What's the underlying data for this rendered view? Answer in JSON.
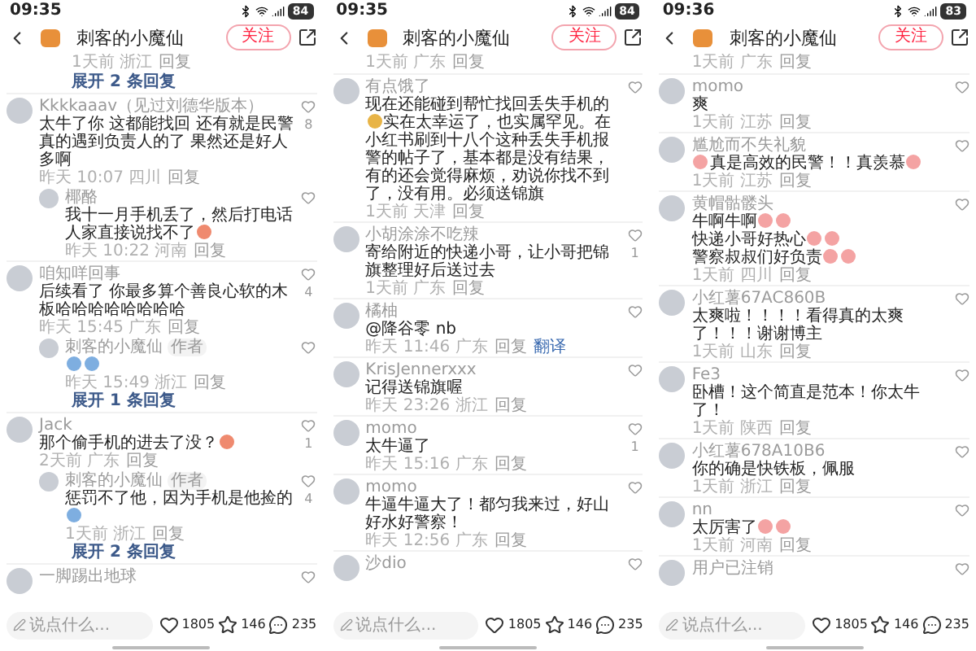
{
  "panels": [
    {
      "status": {
        "time": "09:35",
        "battery": "84"
      },
      "header": {
        "title": "刺客的小魔仙",
        "follow": "关注"
      },
      "comments": [
        {
          "kind": "reply-meta",
          "meta": "1天前 浙江",
          "reply": "回复"
        },
        {
          "kind": "expand",
          "text": "展开 2 条回复"
        },
        {
          "kind": "comment",
          "name": "Kkkkaaav（见过刘德华版本）",
          "body": [
            [
              {
                "kind": "text",
                "text": "太牛了你 这都能找回 还有就是民警真的遇到负责人的了 果然还是好人多啊"
              }
            ]
          ],
          "meta": "昨天 10:07 四川",
          "reply": "回复",
          "likes": "8"
        },
        {
          "kind": "reply",
          "name": "椰酪",
          "body": [
            [
              {
                "kind": "text",
                "text": "我十一月手机丢了，然后打电话人家直接说找不了"
              },
              {
                "kind": "sticker",
                "color": "#ef8a6f"
              }
            ]
          ],
          "meta": "昨天 10:22 河南",
          "reply": "回复"
        },
        {
          "kind": "comment",
          "name": "咱知咩回事",
          "body": [
            [
              {
                "kind": "text",
                "text": "后续看了 你最多算个善良心软的木板哈哈哈哈哈哈哈哈"
              }
            ]
          ],
          "meta": "昨天 15:45 广东",
          "reply": "回复",
          "likes": "4"
        },
        {
          "kind": "reply",
          "name": "刺客的小魔仙",
          "badge": "作者",
          "body": [
            [
              {
                "kind": "sticker",
                "color": "#7eaee0"
              },
              {
                "kind": "sticker",
                "color": "#7eaee0"
              }
            ]
          ],
          "meta": "昨天 15:49 浙江",
          "reply": "回复"
        },
        {
          "kind": "expand",
          "text": "展开 1 条回复"
        },
        {
          "kind": "comment",
          "name": "Jack",
          "body": [
            [
              {
                "kind": "text",
                "text": "那个偷手机的进去了没？"
              },
              {
                "kind": "sticker",
                "color": "#ef8a6f"
              }
            ]
          ],
          "meta": "2天前 广东",
          "reply": "回复",
          "likes": "1"
        },
        {
          "kind": "reply",
          "name": "刺客的小魔仙",
          "badge": "作者",
          "body": [
            [
              {
                "kind": "text",
                "text": "惩罚不了他，因为手机是他捡的"
              },
              {
                "kind": "sticker",
                "color": "#7eaee0"
              }
            ]
          ],
          "meta": "1天前 浙江",
          "reply": "回复",
          "likes": "4"
        },
        {
          "kind": "expand",
          "text": "展开 2 条回复"
        },
        {
          "kind": "comment",
          "name": "一脚踢出地球"
        }
      ],
      "bottom": {
        "placeholder": "说点什么...",
        "likes": "1805",
        "stars": "146",
        "comments": "235"
      }
    },
    {
      "status": {
        "time": "09:35",
        "battery": "84"
      },
      "header": {
        "title": "刺客的小魔仙",
        "follow": "关注"
      },
      "comments": [
        {
          "kind": "meta",
          "meta": "1天前 广东",
          "reply": "回复"
        },
        {
          "kind": "comment",
          "name": "有点饿了",
          "body": [
            [
              {
                "kind": "text",
                "text": "现在还能碰到帮忙找回丢失手机的"
              },
              {
                "kind": "sticker",
                "color": "#e8b447"
              },
              {
                "kind": "text",
                "text": "实在太幸运了，也实属罕见。在小红书刷到十八个这种丢失手机报警的帖子了，基本都是没有结果，有的还会觉得麻烦，劝说你找不到了，没有用。必须送锦旗"
              }
            ]
          ],
          "meta": "1天前 天津",
          "reply": "回复"
        },
        {
          "kind": "comment",
          "name": "小胡涂涂不吃辣",
          "body": [
            [
              {
                "kind": "text",
                "text": "寄给附近的快递小哥，让小哥把锦旗整理好后送过去"
              }
            ]
          ],
          "meta": "1天前 广东",
          "reply": "回复",
          "likes": "1"
        },
        {
          "kind": "comment",
          "name": "橘柚",
          "body": [
            [
              {
                "kind": "text",
                "text": "@降谷零 nb"
              }
            ]
          ],
          "meta": "昨天 11:46 广东",
          "reply": "回复",
          "translate": "翻译"
        },
        {
          "kind": "comment",
          "name": "KrisJennerxxx",
          "body": [
            [
              {
                "kind": "text",
                "text": "记得送锦旗喔"
              }
            ]
          ],
          "meta": "昨天 23:26 浙江",
          "reply": "回复"
        },
        {
          "kind": "comment",
          "name": "momo",
          "body": [
            [
              {
                "kind": "text",
                "text": "太牛逼了"
              }
            ]
          ],
          "meta": "昨天 15:16 广东",
          "reply": "回复",
          "likes": "1"
        },
        {
          "kind": "comment",
          "name": "momo",
          "body": [
            [
              {
                "kind": "text",
                "text": "牛逼牛逼大了！都匀我来过，好山好水好警察！"
              }
            ]
          ],
          "meta": "昨天 12:56 广东",
          "reply": "回复"
        },
        {
          "kind": "comment",
          "name": "沙dio"
        }
      ],
      "bottom": {
        "placeholder": "说点什么...",
        "likes": "1805",
        "stars": "146",
        "comments": "235"
      }
    },
    {
      "status": {
        "time": "09:36",
        "battery": "83"
      },
      "header": {
        "title": "刺客的小魔仙",
        "follow": "关注"
      },
      "comments": [
        {
          "kind": "meta",
          "meta": "1天前 广东",
          "reply": "回复"
        },
        {
          "kind": "comment",
          "name": "momo",
          "body": [
            [
              {
                "kind": "text",
                "text": "爽"
              }
            ]
          ],
          "meta": "1天前 江苏",
          "reply": "回复"
        },
        {
          "kind": "comment",
          "name": "尴尬而不失礼貌",
          "body": [
            [
              {
                "kind": "sticker",
                "color": "#f4a3a3"
              },
              {
                "kind": "text",
                "text": "真是高效的民警！！真羡慕"
              },
              {
                "kind": "sticker",
                "color": "#f4a3a3"
              }
            ]
          ],
          "meta": "1天前 江苏",
          "reply": "回复"
        },
        {
          "kind": "comment",
          "name": "黄帽骷髅头",
          "body": [
            [
              {
                "kind": "text",
                "text": "牛啊牛啊"
              },
              {
                "kind": "sticker",
                "color": "#f4a3a3"
              },
              {
                "kind": "sticker",
                "color": "#f4a3a3"
              }
            ],
            [
              {
                "kind": "text",
                "text": "快递小哥好热心"
              },
              {
                "kind": "sticker",
                "color": "#f4a3a3"
              },
              {
                "kind": "sticker",
                "color": "#f4a3a3"
              }
            ],
            [
              {
                "kind": "text",
                "text": "警察叔叔们好负责"
              },
              {
                "kind": "sticker",
                "color": "#f4a3a3"
              },
              {
                "kind": "sticker",
                "color": "#f4a3a3"
              }
            ]
          ],
          "meta": "1天前 四川",
          "reply": "回复"
        },
        {
          "kind": "comment",
          "name": "小红薯67AC860B",
          "body": [
            [
              {
                "kind": "text",
                "text": "太爽啦！！！！看得真的太爽了！！！谢谢博主"
              }
            ]
          ],
          "meta": "1天前 山东",
          "reply": "回复"
        },
        {
          "kind": "comment",
          "name": "Fe3",
          "body": [
            [
              {
                "kind": "text",
                "text": "卧槽！这个简直是范本！你太牛了！"
              }
            ]
          ],
          "meta": "1天前 陕西",
          "reply": "回复"
        },
        {
          "kind": "comment",
          "name": "小红薯678A10B6",
          "body": [
            [
              {
                "kind": "text",
                "text": "你的确是快铁板，佩服"
              }
            ]
          ],
          "meta": "1天前 浙江",
          "reply": "回复"
        },
        {
          "kind": "comment",
          "name": "nn",
          "body": [
            [
              {
                "kind": "text",
                "text": "太厉害了"
              },
              {
                "kind": "sticker",
                "color": "#f4a3a3"
              },
              {
                "kind": "sticker",
                "color": "#f4a3a3"
              }
            ]
          ],
          "meta": "1天前 河南",
          "reply": "回复"
        },
        {
          "kind": "comment",
          "name": "用户已注销"
        }
      ],
      "bottom": {
        "placeholder": "说点什么...",
        "likes": "1805",
        "stars": "146",
        "comments": "235"
      }
    }
  ]
}
